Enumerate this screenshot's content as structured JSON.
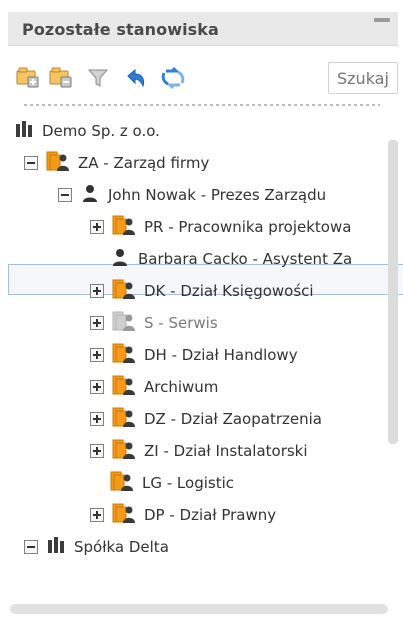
{
  "panel": {
    "title": "Pozostałe stanowiska"
  },
  "toolbar": {
    "search_placeholder": "Szukaj",
    "icons": [
      "add-folder-icon",
      "folder-icon",
      "filter-icon",
      "undo-icon",
      "refresh-icon"
    ]
  },
  "tree": {
    "items": [
      {
        "label": "Demo Sp. z o.o.",
        "type": "company",
        "expand": "none"
      },
      {
        "label": "ZA - Zarząd firmy",
        "type": "department",
        "expand": "minus"
      },
      {
        "label": "John Nowak - Prezes Zarządu",
        "type": "person",
        "expand": "minus"
      },
      {
        "label": "PR - Pracownika projektowa",
        "type": "department",
        "expand": "plus"
      },
      {
        "label": "Barbara Cacko - Asystent Za",
        "type": "person",
        "expand": "none",
        "selected": true
      },
      {
        "label": "DK - Dział Księgowości",
        "type": "department",
        "expand": "plus"
      },
      {
        "label": "S - Serwis",
        "type": "department-disabled",
        "expand": "plus"
      },
      {
        "label": "DH - Dział Handlowy",
        "type": "department",
        "expand": "plus"
      },
      {
        "label": "Archiwum",
        "type": "department",
        "expand": "plus"
      },
      {
        "label": "DZ - Dział Zaopatrzenia",
        "type": "department",
        "expand": "plus"
      },
      {
        "label": "ZI - Dział Instalatorski",
        "type": "department",
        "expand": "plus"
      },
      {
        "label": "LG - Logistic",
        "type": "department",
        "expand": "none"
      },
      {
        "label": "DP - Dział Prawny",
        "type": "department",
        "expand": "plus"
      },
      {
        "label": "Spółka Delta",
        "type": "company",
        "expand": "minus"
      }
    ]
  },
  "colors": {
    "header_bg": "#e9e9e9",
    "selection_bg": "#f5f7fb",
    "selection_border": "#a6bfdc",
    "folder_orange": "#f39b1a",
    "refresh_blue": "#2f7ed8"
  }
}
